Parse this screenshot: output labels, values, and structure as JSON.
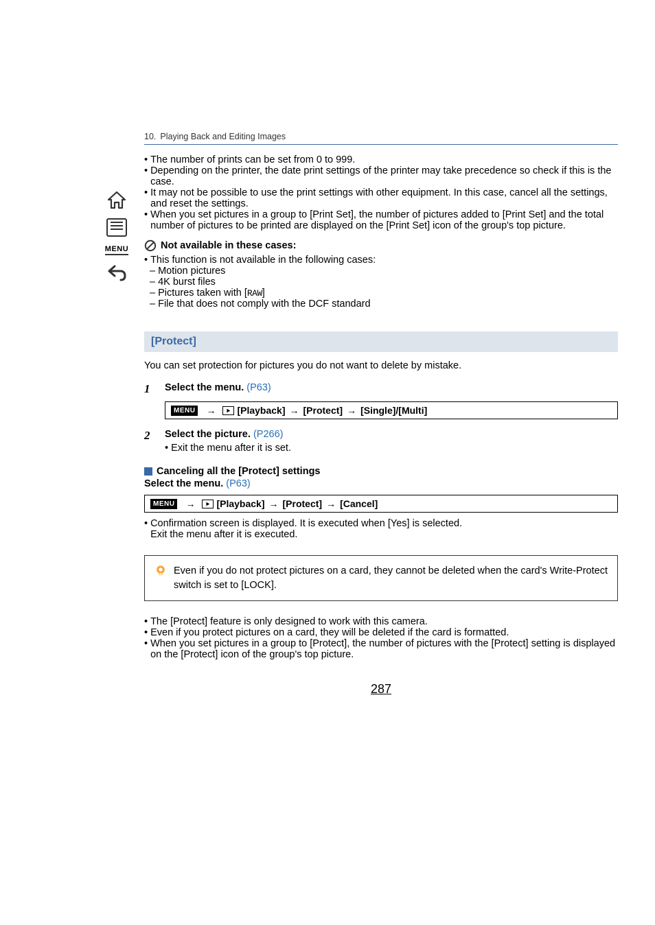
{
  "breadcrumb": {
    "chapter": "10.",
    "title": "Playing Back and Editing Images"
  },
  "top_bullets": [
    "The number of prints can be set from 0 to 999.",
    "Depending on the printer, the date print settings of the printer may take precedence so check if this is the case.",
    "It may not be possible to use the print settings with other equipment. In this case, cancel all the settings, and reset the settings.",
    "When you set pictures in a group to [Print Set], the number of pictures added to [Print Set] and the total number of pictures to be printed are displayed on the [Print Set] icon of the group's top picture."
  ],
  "not_available": {
    "heading": "Not available in these cases:",
    "lead": "This function is not available in the following cases:",
    "items_before_raw": [
      "Motion pictures",
      "4K burst files"
    ],
    "raw_prefix": "Pictures taken with [",
    "raw_label": "RAW",
    "raw_suffix": "]",
    "items_after_raw": [
      "File that does not comply with the DCF standard"
    ]
  },
  "section": {
    "title": "[Protect]",
    "intro": "You can set protection for pictures you do not want to delete by mistake."
  },
  "steps": [
    {
      "n": "1",
      "title": "Select the menu. ",
      "link": "(P63)"
    },
    {
      "n": "2",
      "title": "Select the picture. ",
      "link": "(P266)",
      "sub": "Exit the menu after it is set."
    }
  ],
  "menu_path1": {
    "menu_label": "MENU",
    "items": [
      "[Playback]",
      "[Protect]",
      "[Single]/[Multi]"
    ]
  },
  "cancel_header": "Canceling all the [Protect] settings",
  "cancel_select": "Select the menu. ",
  "cancel_select_link": "(P63)",
  "menu_path2": {
    "menu_label": "MENU",
    "items": [
      "[Playback]",
      "[Protect]",
      "[Cancel]"
    ]
  },
  "confirm_text": "Confirmation screen is displayed. It is executed when [Yes] is selected.",
  "confirm_exit": "Exit the menu after it is executed.",
  "tip": "Even if you do not protect pictures on a card, they cannot be deleted when the card's Write-Protect switch is set to [LOCK].",
  "bottom_bullets": [
    "The [Protect] feature is only designed to work with this camera.",
    "Even if you protect pictures on a card, they will be deleted if the card is formatted.",
    "When you set pictures in a group to [Protect], the number of pictures with the [Protect] setting is displayed on the [Protect] icon of the group's top picture."
  ],
  "page_number": "287",
  "sidebar": {
    "menu_label": "MENU"
  },
  "arrows": {
    "r": "→"
  }
}
